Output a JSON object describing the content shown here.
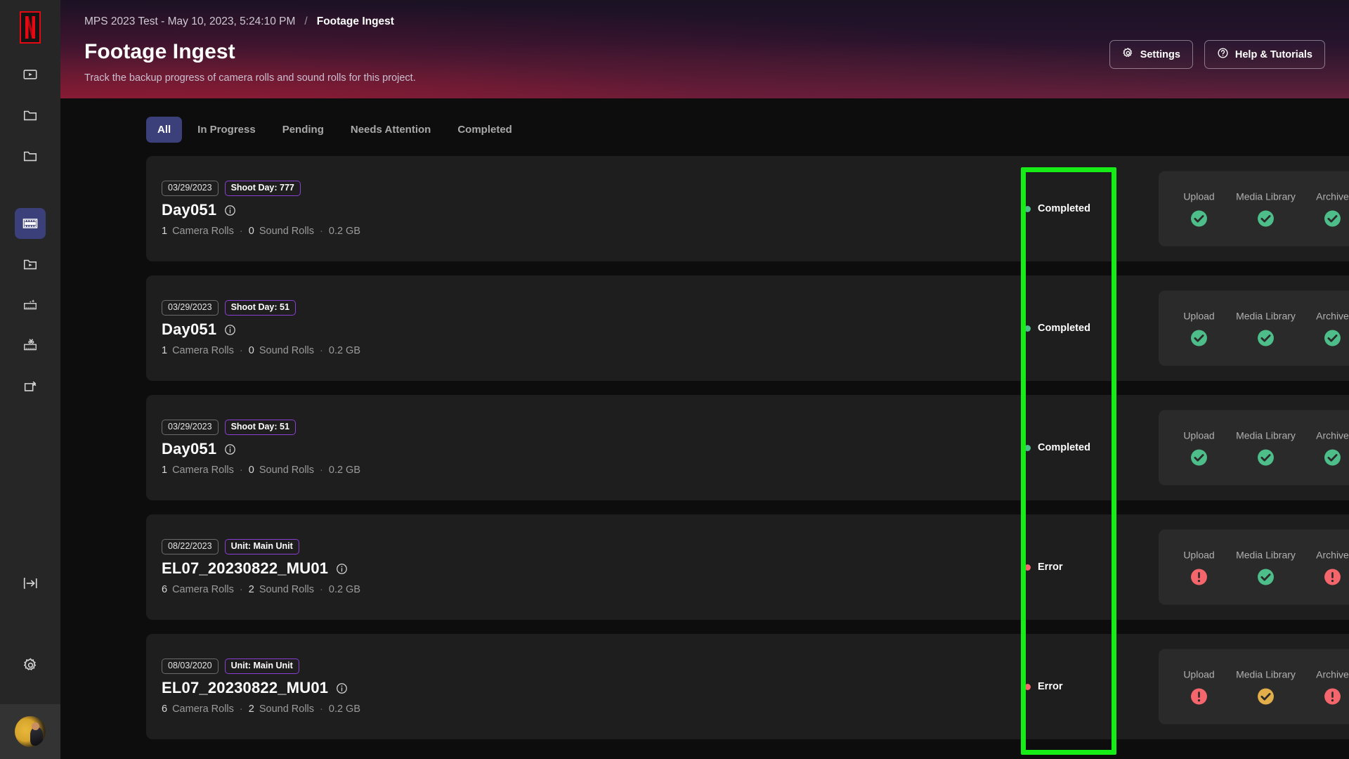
{
  "sidebar": {
    "logo": "netflix-n-logo",
    "items": [
      {
        "name": "video-player-icon",
        "active": false
      },
      {
        "name": "folder-icon",
        "active": false
      },
      {
        "name": "folder-alt-icon",
        "active": false
      },
      {
        "name": "film-strip-icon",
        "active": true
      },
      {
        "name": "folder-video-icon",
        "active": false
      },
      {
        "name": "film-sparkle-icon",
        "active": false
      },
      {
        "name": "film-cut-icon",
        "active": false
      },
      {
        "name": "archive-box-icon",
        "active": false
      }
    ],
    "bottom": [
      {
        "name": "collapse-sidebar-icon"
      },
      {
        "name": "settings-gear-icon"
      }
    ],
    "avatar_alt": "user-avatar"
  },
  "header": {
    "breadcrumb_project": "MPS 2023 Test - May 10, 2023, 5:24:10 PM",
    "breadcrumb_separator": "/",
    "breadcrumb_current": "Footage Ingest",
    "title": "Footage Ingest",
    "subtitle": "Track the backup progress of camera rolls and sound rolls for this project.",
    "settings_label": "Settings",
    "help_label": "Help & Tutorials",
    "gradient_top": "#1b1224",
    "gradient_bottom": "#63203c"
  },
  "tabs": [
    {
      "label": "All",
      "active": true
    },
    {
      "label": "In Progress",
      "active": false
    },
    {
      "label": "Pending",
      "active": false
    },
    {
      "label": "Needs Attention",
      "active": false
    },
    {
      "label": "Completed",
      "active": false
    }
  ],
  "colors": {
    "accent_tab": "#3b3f7a",
    "badge_accent": "#8b3fd4",
    "status_completed": "#4dbd89",
    "status_error": "#f4666b",
    "status_warning": "#e2ae4a",
    "highlight": "#16ec16"
  },
  "stage_labels": [
    "Upload",
    "Media Library",
    "Archive"
  ],
  "cards": [
    {
      "date": "03/29/2023",
      "tag": "Shoot Day: 777",
      "title": "Day051",
      "camera_rolls": "1",
      "camera_rolls_label": "Camera Rolls",
      "sound_rolls": "0",
      "sound_rolls_label": "Sound Rolls",
      "size": "0.2 GB",
      "status": "Completed",
      "status_type": "completed",
      "stages": [
        "completed",
        "completed",
        "completed"
      ]
    },
    {
      "date": "03/29/2023",
      "tag": "Shoot Day: 51",
      "title": "Day051",
      "camera_rolls": "1",
      "camera_rolls_label": "Camera Rolls",
      "sound_rolls": "0",
      "sound_rolls_label": "Sound Rolls",
      "size": "0.2 GB",
      "status": "Completed",
      "status_type": "completed",
      "stages": [
        "completed",
        "completed",
        "completed"
      ]
    },
    {
      "date": "03/29/2023",
      "tag": "Shoot Day: 51",
      "title": "Day051",
      "camera_rolls": "1",
      "camera_rolls_label": "Camera Rolls",
      "sound_rolls": "0",
      "sound_rolls_label": "Sound Rolls",
      "size": "0.2 GB",
      "status": "Completed",
      "status_type": "completed",
      "stages": [
        "completed",
        "completed",
        "completed"
      ]
    },
    {
      "date": "08/22/2023",
      "tag": "Unit: Main Unit",
      "title": "EL07_20230822_MU01",
      "camera_rolls": "6",
      "camera_rolls_label": "Camera Rolls",
      "sound_rolls": "2",
      "sound_rolls_label": "Sound Rolls",
      "size": "0.2 GB",
      "status": "Error",
      "status_type": "error",
      "stages": [
        "error",
        "completed",
        "error"
      ]
    },
    {
      "date": "08/03/2020",
      "tag": "Unit: Main Unit",
      "title": "EL07_20230822_MU01",
      "camera_rolls": "6",
      "camera_rolls_label": "Camera Rolls",
      "sound_rolls": "2",
      "sound_rolls_label": "Sound Rolls",
      "size": "0.2 GB",
      "status": "Error",
      "status_type": "error",
      "stages": [
        "error",
        "warning",
        "error"
      ]
    }
  ],
  "separators": {
    "meta_dot": "·"
  }
}
